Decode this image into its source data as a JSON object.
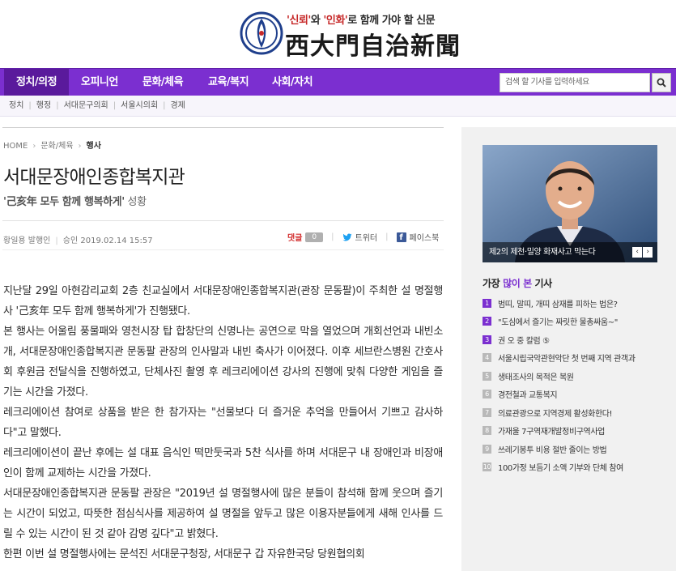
{
  "header": {
    "slogan_parts": [
      "'신뢰'",
      "와 ",
      "'인화'",
      "로 함께 가야 할 신문"
    ],
    "site_name": "西大門自治新聞"
  },
  "nav": {
    "items": [
      "정치/의정",
      "오피니언",
      "문화/체육",
      "교육/복지",
      "사회/자치"
    ],
    "search_placeholder": "검색 할 기사를 입력하세요",
    "search_icon": "search-icon",
    "accent_color": "#7b2fd0"
  },
  "subnav": {
    "items": [
      "정치",
      "행정",
      "서대문구의회",
      "서울시의회",
      "경제"
    ]
  },
  "breadcrumb": {
    "home": "HOME",
    "section": "문화/체육",
    "current": "행사"
  },
  "article": {
    "title": "서대문장애인종합복지관",
    "subtitle_quote": "'己亥年 모두 함께 행복하게'",
    "subtitle_rest": " 성황",
    "author": "황일용 발행인",
    "approved_label": "승인",
    "approved_date": "2019.02.14 15:57",
    "comment_label": "댓글",
    "comment_count": "0",
    "twitter_label": "트위터",
    "facebook_label": "페이스북",
    "paragraphs": [
      "지난달 29일 아현감리교회 2층 친교실에서 서대문장애인종합복지관(관장 문동팔)이 주최한 설 명절행사 '己亥年 모두 함께 행복하게'가 진행됐다.",
      "본 행사는 어울림 풍물패와 영천시장 탑 합창단의 신명나는 공연으로 막을 열었으며 개회선언과 내빈소개, 서대문장애인종합복지관 문동팔 관장의 인사말과 내빈 축사가 이어졌다. 이후 세브란스병원 간호사회 후원금 전달식을 진행하였고, 단체사진 촬영 후 레크리에이션 강사의 진행에 맞춰 다양한 게임을 즐기는 시간을 가졌다.",
      "레크리에이션 참여로 상품을 받은 한 참가자는 \"선물보다 더 즐거운 추억을 만들어서 기쁘고 감사하다\"고 말했다.",
      "레크리에이션이 끝난 후에는 설 대표 음식인 떡만둣국과 5찬 식사를 하며 서대문구 내 장애인과 비장애인이 함께 교제하는 시간을 가졌다.",
      "서대문장애인종합복지관 문동팔 관장은 \"2019년 설 명절행사에 많은 분들이 참석해 함께 웃으며 즐기는 시간이 되었고, 따뜻한 점심식사를 제공하여 설 명절을 앞두고 많은 이용자분들에게 새해 인사를 드릴 수 있는 시간이 된 것 같아 감명 깊다\"고 밝혔다.",
      "한편 이번 설 명절행사에는 문석진 서대문구청장, 서대문구 갑 자유한국당 당원협의회"
    ]
  },
  "sidebar": {
    "photo_caption": "제2의 제천·밀양 화재사고 막는다",
    "prev_icon": "chevron-left-icon",
    "next_icon": "chevron-right-icon",
    "popular_title_prefix": "가장 ",
    "popular_title_highlight": "많이 본",
    "popular_title_suffix": " 기사",
    "popular": [
      {
        "num": "1",
        "title": "범띠, 말띠, 개띠 삼재를 피하는 법은?"
      },
      {
        "num": "2",
        "title": "\"도심에서 즐기는 짜릿한 물총싸움~\""
      },
      {
        "num": "3",
        "title": "권 오 중 칼럼 ⑤"
      },
      {
        "num": "4",
        "title": "서울시립국악관현악단 첫 번째 지역 관객과"
      },
      {
        "num": "5",
        "title": "생태조사의 목적은 복원"
      },
      {
        "num": "6",
        "title": "경전철과 교통복지"
      },
      {
        "num": "7",
        "title": "의료관광으로 지역경제 활성화한다!"
      },
      {
        "num": "8",
        "title": "가재울 7구역재개발정비구역사업"
      },
      {
        "num": "9",
        "title": "쓰레기봉투 비용 절반 줄이는 방법"
      },
      {
        "num": "10",
        "title": "100가정 보듬기 소액 기부와 단체 참여"
      }
    ]
  }
}
